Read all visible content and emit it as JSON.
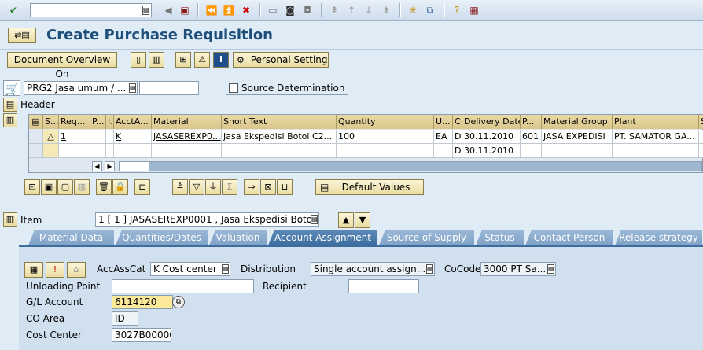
{
  "title": "Create Purchase Requisition",
  "toolbar": {
    "command_field": ""
  },
  "appbar": {
    "doc_overview": "Document Overview On",
    "personal_setting": "Personal Setting"
  },
  "header": {
    "doc_type": "PRG2 Jasa  umum / ...",
    "doc_number": "",
    "source_determination": "Source Determination",
    "header_label": "Header"
  },
  "table": {
    "columns": [
      "S...",
      "Req...",
      "P...",
      "I...",
      "AcctA...",
      "Material",
      "Short Text",
      "Quantity",
      "U...",
      "C",
      "Delivery Date",
      "P...",
      "Material Group",
      "Plant",
      "S"
    ],
    "rows": [
      {
        "status": "△",
        "req": "1",
        "p": "",
        "i": "",
        "acct": "K",
        "material": "JASASEREXP0...",
        "short_text": "Jasa Ekspedisi Botol C2...",
        "quantity": "100",
        "unit": "EA",
        "c": "D",
        "delivery_date": "30.11.2010",
        "p2": "601",
        "mat_group": "JASA EXPEDISI",
        "plant": "PT. SAMATOR GA..."
      },
      {
        "status": "",
        "req": "",
        "p": "",
        "i": "",
        "acct": "",
        "material": "",
        "short_text": "",
        "quantity": "",
        "unit": "",
        "c": "D",
        "delivery_date": "30.11.2010",
        "p2": "",
        "mat_group": "",
        "plant": ""
      }
    ]
  },
  "table_toolbar": {
    "default_values": "Default Values"
  },
  "item": {
    "label": "Item",
    "value": "1 [ 1 ] JASASEREXP0001 , Jasa Ekspedisi Boto..."
  },
  "tabs": [
    "Material Data",
    "Quantities/Dates",
    "Valuation",
    "Account Assignment",
    "Source of Supply",
    "Status",
    "Contact Person",
    "Release strategy"
  ],
  "active_tab": "Account Assignment",
  "account": {
    "accasscat_label": "AccAssCat",
    "accasscat_value": "K Cost center",
    "distribution_label": "Distribution",
    "distribution_value": "Single account assign...",
    "cocode_label": "CoCode",
    "cocode_value": "3000 PT Sa...",
    "unloading_label": "Unloading Point",
    "unloading_value": "",
    "recipient_label": "Recipient",
    "recipient_value": "",
    "gl_label": "G/L Account",
    "gl_value": "6114120",
    "coarea_label": "CO Area",
    "coarea_value": "ID",
    "costcenter_label": "Cost Center",
    "costcenter_value": "3027B00000"
  }
}
